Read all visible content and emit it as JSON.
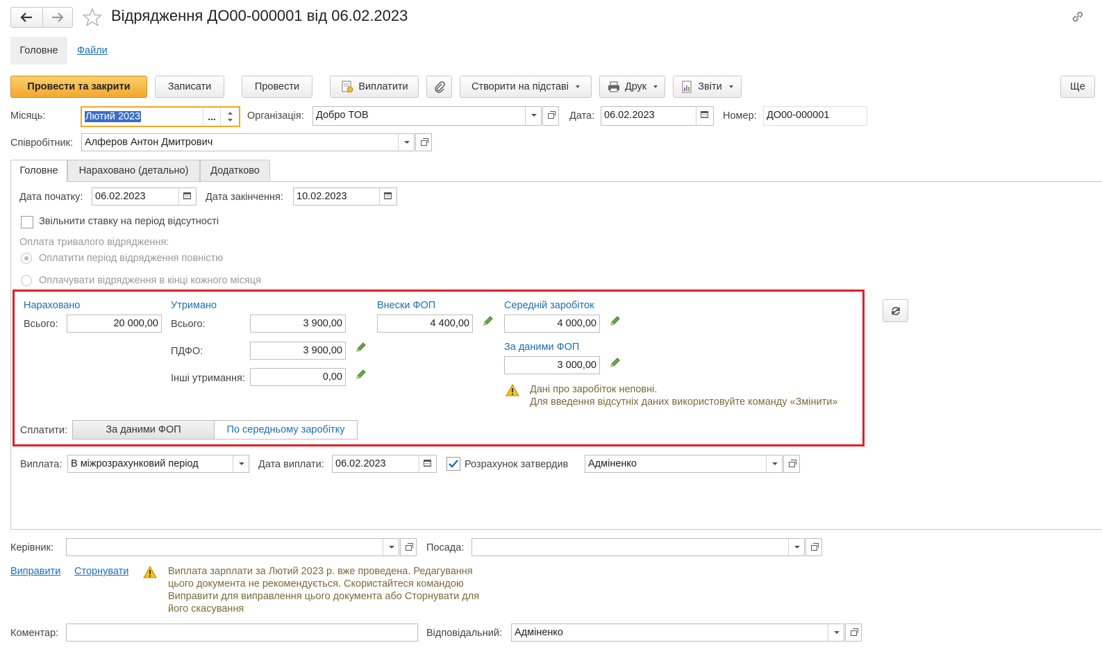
{
  "window": {
    "title": "Відрядження ДО00-000001 від 06.02.2023"
  },
  "sections": {
    "main": "Головне",
    "files": "Файли"
  },
  "toolbar": {
    "post_close": "Провести та закрити",
    "save": "Записати",
    "post": "Провести",
    "pay": "Виплатити",
    "create_based": "Створити на підставі",
    "print": "Друк",
    "reports": "Звіти",
    "more": "Ще"
  },
  "header": {
    "month_label": "Місяць:",
    "month_value": "Лютий 2023",
    "month_select": "...",
    "org_label": "Організація:",
    "org_value": "Добро ТОВ",
    "date_label": "Дата:",
    "date_value": "06.02.2023",
    "number_label": "Номер:",
    "number_value": "ДО00-000001",
    "employee_label": "Співробітник:",
    "employee_value": "Алферов Антон Дмитрович"
  },
  "tabs": [
    "Головне",
    "Нараховано (детально)",
    "Додатково"
  ],
  "main_tab": {
    "start_label": "Дата початку:",
    "start_value": "06.02.2023",
    "end_label": "Дата закінчення:",
    "end_value": "10.02.2023",
    "free_rate_label": "Звільнити ставку на період відсутності",
    "long_trip_label": "Оплата тривалого відрядження:",
    "radio_full": "Оплатити період відрядження повністю",
    "radio_monthly": "Оплачувати відрядження в кінці кожного місяця"
  },
  "summary": {
    "accrued_title": "Нараховано",
    "total_label": "Всього:",
    "accrued_total": "20 000,00",
    "withheld_title": "Утримано",
    "withheld_total_label": "Всього:",
    "withheld_total": "3 900,00",
    "pdfo_label": "ПДФО:",
    "pdfo_value": "3 900,00",
    "other_label": "Інші утримання:",
    "other_value": "0,00",
    "fop_title": "Внески ФОП",
    "fop_value": "4 400,00",
    "avg_title": "Середній заробіток",
    "avg_value": "4 000,00",
    "fop_data_title": "За даними ФОП",
    "fop_data_value": "3 000,00",
    "warn_line1": "Дані про заробіток неповні.",
    "warn_line2": "Для введення відсутніх даних використовуйте команду «Змінити»",
    "pay_label": "Сплатити:",
    "pay_opt1": "За даними ФОП",
    "pay_opt2": "По середньому заробітку"
  },
  "payment": {
    "label": "Виплата:",
    "value": "В міжрозрахунковий період",
    "date_label": "Дата виплати:",
    "date_value": "06.02.2023",
    "approved_label": "Розрахунок затвердив",
    "approved_value": "Адміненко"
  },
  "footer": {
    "manager_label": "Керівник:",
    "manager_value": "",
    "position_label": "Посада:",
    "position_value": "",
    "fix_link": "Виправити",
    "reverse_link": "Сторнувати",
    "warn_lines": [
      "Виплата зарплати за Лютий 2023 р. вже проведена. Редагування",
      "цього документа не рекомендується. Скористайтеся командою",
      "Виправити для виправлення цього документа або Сторнувати для",
      "його скасування"
    ],
    "comment_label": "Коментар:",
    "comment_value": "",
    "responsible_label": "Відповідальний:",
    "responsible_value": "Адміненко"
  },
  "colors": {
    "accent": "#1a6fb6",
    "primary_button": "#f5b94a",
    "highlight_border": "#e31e24",
    "focus_border": "#f5a623",
    "pencil": "#6aa84f"
  }
}
